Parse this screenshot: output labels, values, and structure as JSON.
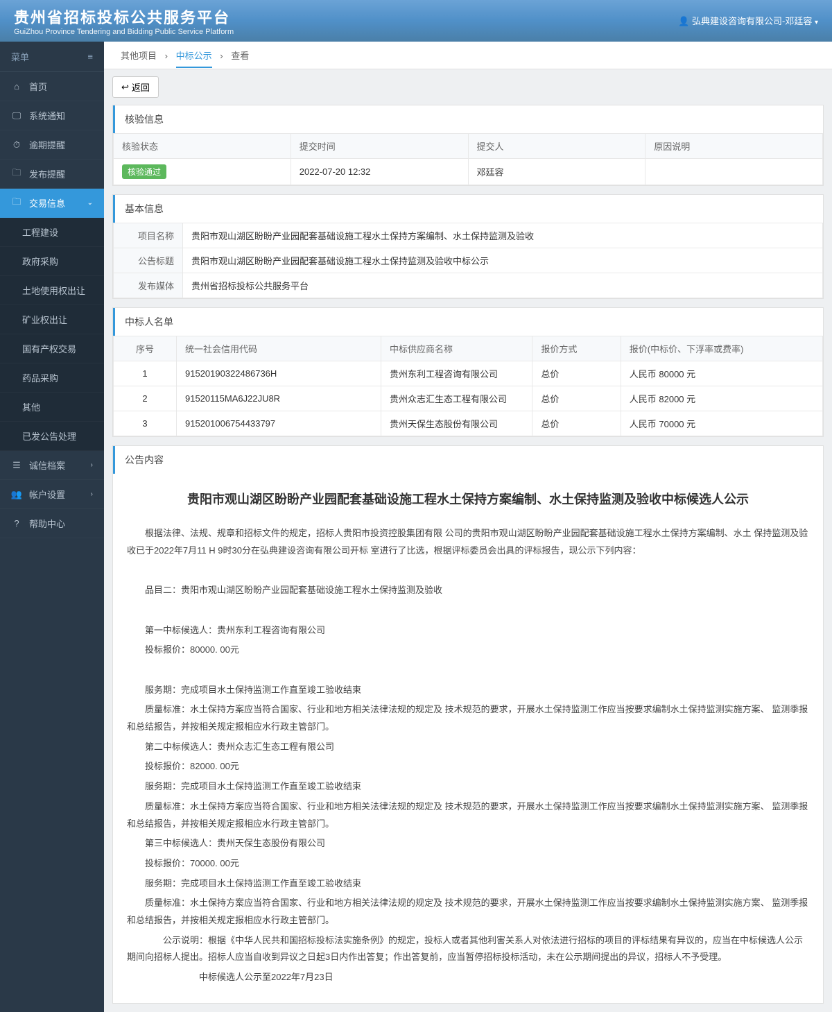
{
  "header": {
    "title": "贵州省招标投标公共服务平台",
    "subtitle": "GuiZhou Province Tendering and Bidding Public Service Platform",
    "user": "弘典建设咨询有限公司-邓廷容"
  },
  "sidebar": {
    "menu_label": "菜单",
    "items": [
      {
        "label": "首页",
        "icon": "home"
      },
      {
        "label": "系统通知",
        "icon": "monitor"
      },
      {
        "label": "逾期提醒",
        "icon": "clock"
      },
      {
        "label": "发布提醒",
        "icon": "folder"
      },
      {
        "label": "交易信息",
        "icon": "folder",
        "active": true,
        "expanded": true,
        "children": [
          {
            "label": "工程建设"
          },
          {
            "label": "政府采购"
          },
          {
            "label": "土地使用权出让"
          },
          {
            "label": "矿业权出让"
          },
          {
            "label": "国有产权交易"
          },
          {
            "label": "药品采购"
          },
          {
            "label": "其他"
          },
          {
            "label": "已发公告处理"
          }
        ]
      },
      {
        "label": "诚信档案",
        "icon": "list",
        "chevron": true
      },
      {
        "label": "帐户设置",
        "icon": "user",
        "chevron": true
      },
      {
        "label": "帮助中心",
        "icon": "help"
      }
    ]
  },
  "breadcrumb": {
    "items": [
      "其他项目",
      "中标公示",
      "查看"
    ]
  },
  "back_label": "返回",
  "verification": {
    "title": "核验信息",
    "headers": {
      "status": "核验状态",
      "time": "提交时间",
      "submitter": "提交人",
      "reason": "原因说明"
    },
    "status_badge": "核验通过",
    "time": "2022-07-20 12:32",
    "submitter": "邓廷容",
    "reason": ""
  },
  "basic_info": {
    "title": "基本信息",
    "rows": [
      {
        "label": "项目名称",
        "value": "贵阳市观山湖区盼盼产业园配套基础设施工程水土保持方案编制、水土保持监测及验收"
      },
      {
        "label": "公告标题",
        "value": "贵阳市观山湖区盼盼产业园配套基础设施工程水土保持监测及验收中标公示"
      },
      {
        "label": "发布媒体",
        "value": "贵州省招标投标公共服务平台"
      }
    ]
  },
  "winners": {
    "title": "中标人名单",
    "headers": {
      "seq": "序号",
      "code": "统一社会信用代码",
      "name": "中标供应商名称",
      "method": "报价方式",
      "price": "报价(中标价、下浮率或费率)"
    },
    "rows": [
      {
        "seq": "1",
        "code": "91520190322486736H",
        "name": "贵州东利工程咨询有限公司",
        "method": "总价",
        "price": "人民币 80000 元"
      },
      {
        "seq": "2",
        "code": "91520115MA6J22JU8R",
        "name": "贵州众志汇生态工程有限公司",
        "method": "总价",
        "price": "人民币 82000 元"
      },
      {
        "seq": "3",
        "code": "915201006754433797",
        "name": "贵州天保生态股份有限公司",
        "method": "总价",
        "price": "人民币 70000 元"
      }
    ]
  },
  "announcement": {
    "title": "公告内容",
    "heading": "贵阳市观山湖区盼盼产业园配套基础设施工程水土保持方案编制、水土保持监测及验收中标候选人公示",
    "intro": "根据法律、法规、规章和招标文件的规定，招标人贵阳市投资控股集团有限 公司的贵阳市观山湖区盼盼产业园配套基础设施工程水土保持方案编制、水土 保持监测及验收已于2022年7月11 H 9时30分在弘典建设咨询有限公司开标 室进行了比选，根据评标委员会出具的评标报告，现公示下列内容：",
    "item_title": "品目二：贵阳市观山湖区盼盼产业园配套基础设施工程水土保持监测及验收",
    "candidates": [
      {
        "rank": "第一中标候选人：贵州东利工程咨询有限公司",
        "price": "投标报价：80000. 00元",
        "period": "服务期：完成项目水土保持监测工作直至竣工验收结束",
        "quality": "质量标准：水土保持方案应当符合国家、行业和地方相关法律法规的规定及 技术规范的要求，开展水土保持监测工作应当按要求编制水土保持监测实施方案、 监测季报和总结报告，并按相关规定报相应水行政主管部门。"
      },
      {
        "rank": "第二中标候选人：贵州众志汇生态工程有限公司",
        "price": "投标报价：82000. 00元",
        "period": "服务期：完成项目水土保持监测工作直至竣工验收结束",
        "quality": "质量标准：水土保持方案应当符合国家、行业和地方相关法律法规的规定及 技术规范的要求，开展水土保持监测工作应当按要求编制水土保持监测实施方案、 监测季报和总结报告，并按相关规定报相应水行政主管部门。"
      },
      {
        "rank": "第三中标候选人：贵州天保生态股份有限公司",
        "price": "投标报价：70000. 00元",
        "period": "服务期：完成项目水土保持监测工作直至竣工验收结束",
        "quality": "质量标准：水土保持方案应当符合国家、行业和地方相关法律法规的规定及 技术规范的要求，开展水土保持监测工作应当按要求编制水土保持监测实施方案、 监测季报和总结报告，并按相关规定报相应水行政主管部门。"
      }
    ],
    "notice": "公示说明：根据《中华人民共和国招标投标法实施条例》的规定，投标人或者其他利害关系人对依法进行招标的项目的评标结果有异议的，应当在中标候选人公示期间向招标人提出。招标人应当自收到异议之日起3日内作出答复；作出答复前，应当暂停招标投标活动，未在公示期间提出的异议，招标人不予受理。",
    "deadline": "中标候选人公示至2022年7月23日"
  }
}
